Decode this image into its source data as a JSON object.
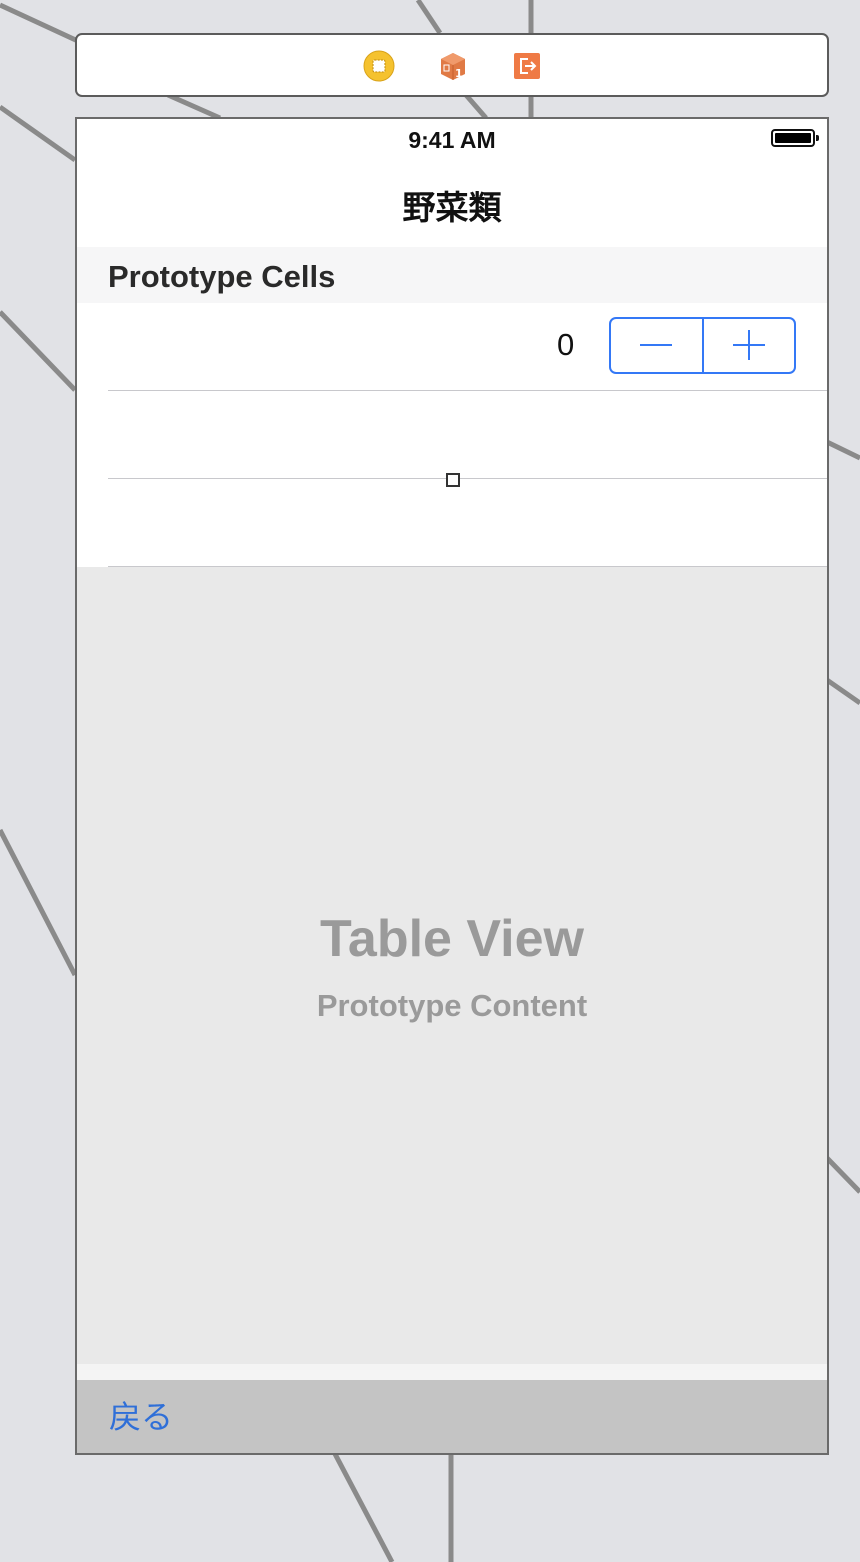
{
  "scene_dock": {
    "icons": [
      "view-controller-icon",
      "first-responder-icon",
      "exit-icon"
    ],
    "colors": {
      "view_controller": "#f5c22f",
      "first_responder": "#e07a45",
      "exit": "#ef7a45"
    }
  },
  "status_bar": {
    "time": "9:41 AM"
  },
  "nav_bar": {
    "title": "野菜類"
  },
  "table": {
    "section_header": "Prototype Cells",
    "cell": {
      "count_label": "0",
      "stepper": {
        "minus_icon": "minus-icon",
        "plus_icon": "plus-icon"
      }
    },
    "placeholder_title": "Table View",
    "placeholder_subtitle": "Prototype Content"
  },
  "toolbar": {
    "back_label": "戻る"
  },
  "colors": {
    "accent": "#3478f6",
    "canvas": "#e1e2e6",
    "toolbar": "#c4c4c4"
  }
}
